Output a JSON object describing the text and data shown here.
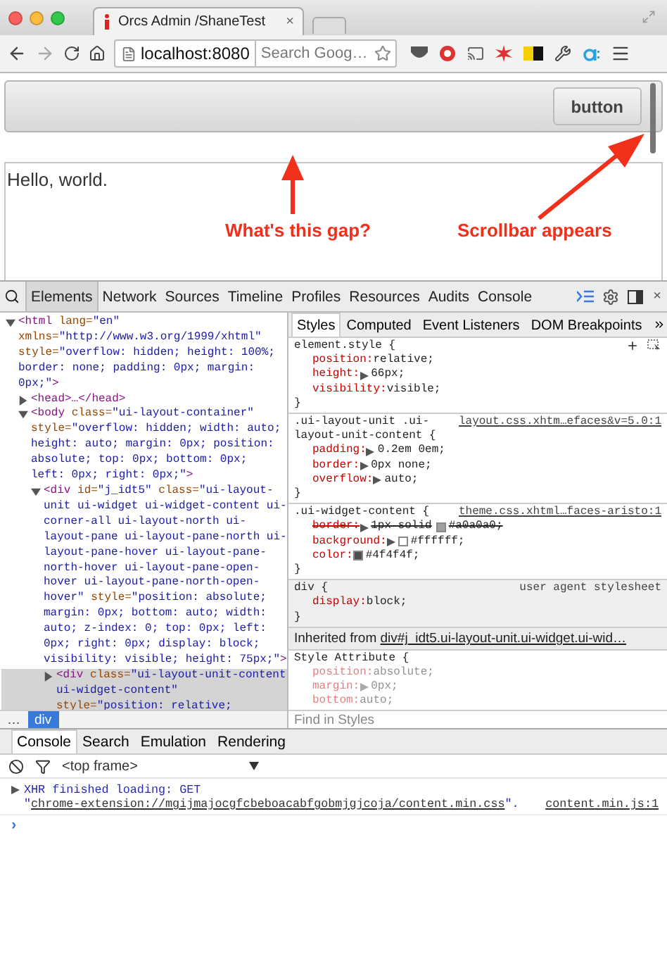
{
  "browser": {
    "tab": {
      "title": "Orcs Admin /ShaneTest",
      "close": "×"
    },
    "url": "localhost:8080",
    "search": {
      "placeholder": "Search Goog…"
    }
  },
  "page": {
    "north_pane": {
      "button": "button"
    },
    "content": "Hello, world.",
    "annotations": [
      {
        "text": "What's this gap?"
      },
      {
        "text": "Scrollbar appears"
      }
    ]
  },
  "devtools": {
    "tabs": [
      {
        "label": "Elements",
        "selected": true
      },
      {
        "label": "Network",
        "selected": false
      },
      {
        "label": "Sources",
        "selected": false
      },
      {
        "label": "Timeline",
        "selected": false
      },
      {
        "label": "Profiles",
        "selected": false
      },
      {
        "label": "Resources",
        "selected": false
      },
      {
        "label": "Audits",
        "selected": false
      },
      {
        "label": "Console",
        "selected": false
      }
    ],
    "close": "×",
    "dom_tree": [
      {
        "expanded": true,
        "selected": false,
        "tokens": [
          {
            "kind": "tag",
            "text": "<html "
          },
          {
            "kind": "attr",
            "text": "lang="
          },
          {
            "kind": "value",
            "text": "\"en\" "
          },
          {
            "kind": "attr",
            "text": "xmlns="
          },
          {
            "kind": "value",
            "text": "\"http://www.w3.org/1999/xhtml\" "
          },
          {
            "kind": "attr",
            "text": "style="
          },
          {
            "kind": "value",
            "text": "\"overflow: hidden; height: 100%; border: none; padding: 0px; margin: 0px;\""
          },
          {
            "kind": "tag",
            "text": ">"
          }
        ],
        "children": [
          {
            "expanded": false,
            "selected": false,
            "tokens": [
              {
                "kind": "tag",
                "text": "<head>…</head>"
              }
            ]
          },
          {
            "expanded": true,
            "selected": false,
            "tokens": [
              {
                "kind": "tag",
                "text": "<body "
              },
              {
                "kind": "attr",
                "text": "class="
              },
              {
                "kind": "value",
                "text": "\"ui-layout-container\" "
              },
              {
                "kind": "attr",
                "text": "style="
              },
              {
                "kind": "value",
                "text": "\"overflow: hidden; width: auto; height: auto; margin: 0px; position: absolute; top: 0px; bottom: 0px; left: 0px; right: 0px;\""
              },
              {
                "kind": "tag",
                "text": ">"
              }
            ],
            "children": [
              {
                "expanded": true,
                "selected": false,
                "tokens": [
                  {
                    "kind": "tag",
                    "text": "<div "
                  },
                  {
                    "kind": "attr",
                    "text": "id="
                  },
                  {
                    "kind": "value",
                    "text": "\"j_idt5\" "
                  },
                  {
                    "kind": "attr",
                    "text": "class="
                  },
                  {
                    "kind": "value",
                    "text": "\"ui-layout-unit ui-widget ui-widget-content ui-corner-all ui-layout-north ui-layout-pane ui-layout-pane-north ui-layout-pane-hover ui-layout-pane-north-hover ui-layout-pane-open-hover ui-layout-pane-north-open-hover\" "
                  },
                  {
                    "kind": "attr",
                    "text": "style="
                  },
                  {
                    "kind": "value",
                    "text": "\"position: absolute; margin: 0px; bottom: auto; width: auto; z-index: 0; top: 0px; left: 0px; right: 0px; display: block; visibility: visible; height: 75px;\""
                  },
                  {
                    "kind": "tag",
                    "text": ">"
                  }
                ],
                "children": [
                  {
                    "expanded": false,
                    "selected": true,
                    "tokens": [
                      {
                        "kind": "tag",
                        "text": "<div "
                      },
                      {
                        "kind": "attr",
                        "text": "class="
                      },
                      {
                        "kind": "value",
                        "text": "\"ui-layout-unit-content ui-widget-content\" "
                      },
                      {
                        "kind": "attr",
                        "text": "style="
                      },
                      {
                        "kind": "value",
                        "text": "\"position: relative;"
                      }
                    ]
                  }
                ]
              }
            ]
          }
        ]
      }
    ],
    "breadcrumbs": [
      {
        "label": "…",
        "selected": false
      },
      {
        "label": "div",
        "selected": true
      }
    ],
    "style_tabs": [
      {
        "label": "Styles",
        "selected": true
      },
      {
        "label": "Computed",
        "selected": false
      },
      {
        "label": "Event Listeners",
        "selected": false
      },
      {
        "label": "DOM Breakpoints",
        "selected": false
      }
    ],
    "rules": [
      {
        "kind": "element",
        "selector": "element.style {",
        "closing": "}",
        "properties": [
          {
            "name": "position:",
            "value": "relative;",
            "expandable": false,
            "struck": false
          },
          {
            "name": "height:",
            "value": "66px;",
            "expandable": true,
            "struck": false
          },
          {
            "name": "visibility:",
            "value": "visible;",
            "expandable": false,
            "struck": false
          }
        ]
      },
      {
        "kind": "author",
        "selector": ".ui-layout-unit .ui-layout-unit-content {",
        "source": "layout.css.xhtm…efaces&v=5.0:1",
        "closing": "}",
        "properties": [
          {
            "name": "padding:",
            "value": "0.2em 0em;",
            "expandable": true,
            "struck": false
          },
          {
            "name": "border:",
            "value": "0px none;",
            "expandable": true,
            "struck": false
          },
          {
            "name": "overflow:",
            "value": "auto;",
            "expandable": true,
            "struck": false
          }
        ]
      },
      {
        "kind": "author",
        "selector": ".ui-widget-content {",
        "source": "theme.css.xhtml…faces-aristo:1",
        "closing": "}",
        "properties": [
          {
            "name": "border:",
            "value": "1px solid",
            "swatch": "#a0a0a0",
            "end": ";",
            "expandable": true,
            "struck": true
          },
          {
            "name": "background:",
            "swatch": "#ffffff",
            "end": ";",
            "expandable": true,
            "struck": false
          },
          {
            "name": "color:",
            "swatch": "#4f4f4f",
            "end": ";",
            "expandable": false,
            "struck": false
          }
        ]
      },
      {
        "kind": "user_agent",
        "selector": "div {",
        "source": "user agent stylesheet",
        "closing": "}",
        "properties": [
          {
            "name": "display:",
            "value": "block;",
            "expandable": false,
            "struck": false
          }
        ]
      }
    ],
    "inherited": {
      "label": "Inherited from",
      "link": "div#j_idt5.ui-layout-unit.ui-widget.ui-wid…"
    },
    "style_attribute": {
      "selector": "Style Attribute {",
      "properties": [
        {
          "name": "position:",
          "value": "absolute;",
          "expandable": false
        },
        {
          "name": "margin:",
          "value": "0px;",
          "expandable": true
        },
        {
          "name": "bottom:",
          "value": "auto;",
          "expandable": false
        }
      ]
    },
    "find": {
      "placeholder": "Find in Styles"
    }
  },
  "drawer": {
    "tabs": [
      {
        "label": "Console",
        "selected": true
      },
      {
        "label": "Search",
        "selected": false
      },
      {
        "label": "Emulation",
        "selected": false
      },
      {
        "label": "Rendering",
        "selected": false
      }
    ],
    "frame": "<top frame>",
    "messages": [
      {
        "prefix": "XHR finished loading: GET \"",
        "link": "chrome-extension://mgijmajocgfcbeboacabfgobmjgjcoja/content.min.css",
        "suffix": "\".",
        "source": "content.min.js:1"
      }
    ],
    "prompt": "›"
  }
}
